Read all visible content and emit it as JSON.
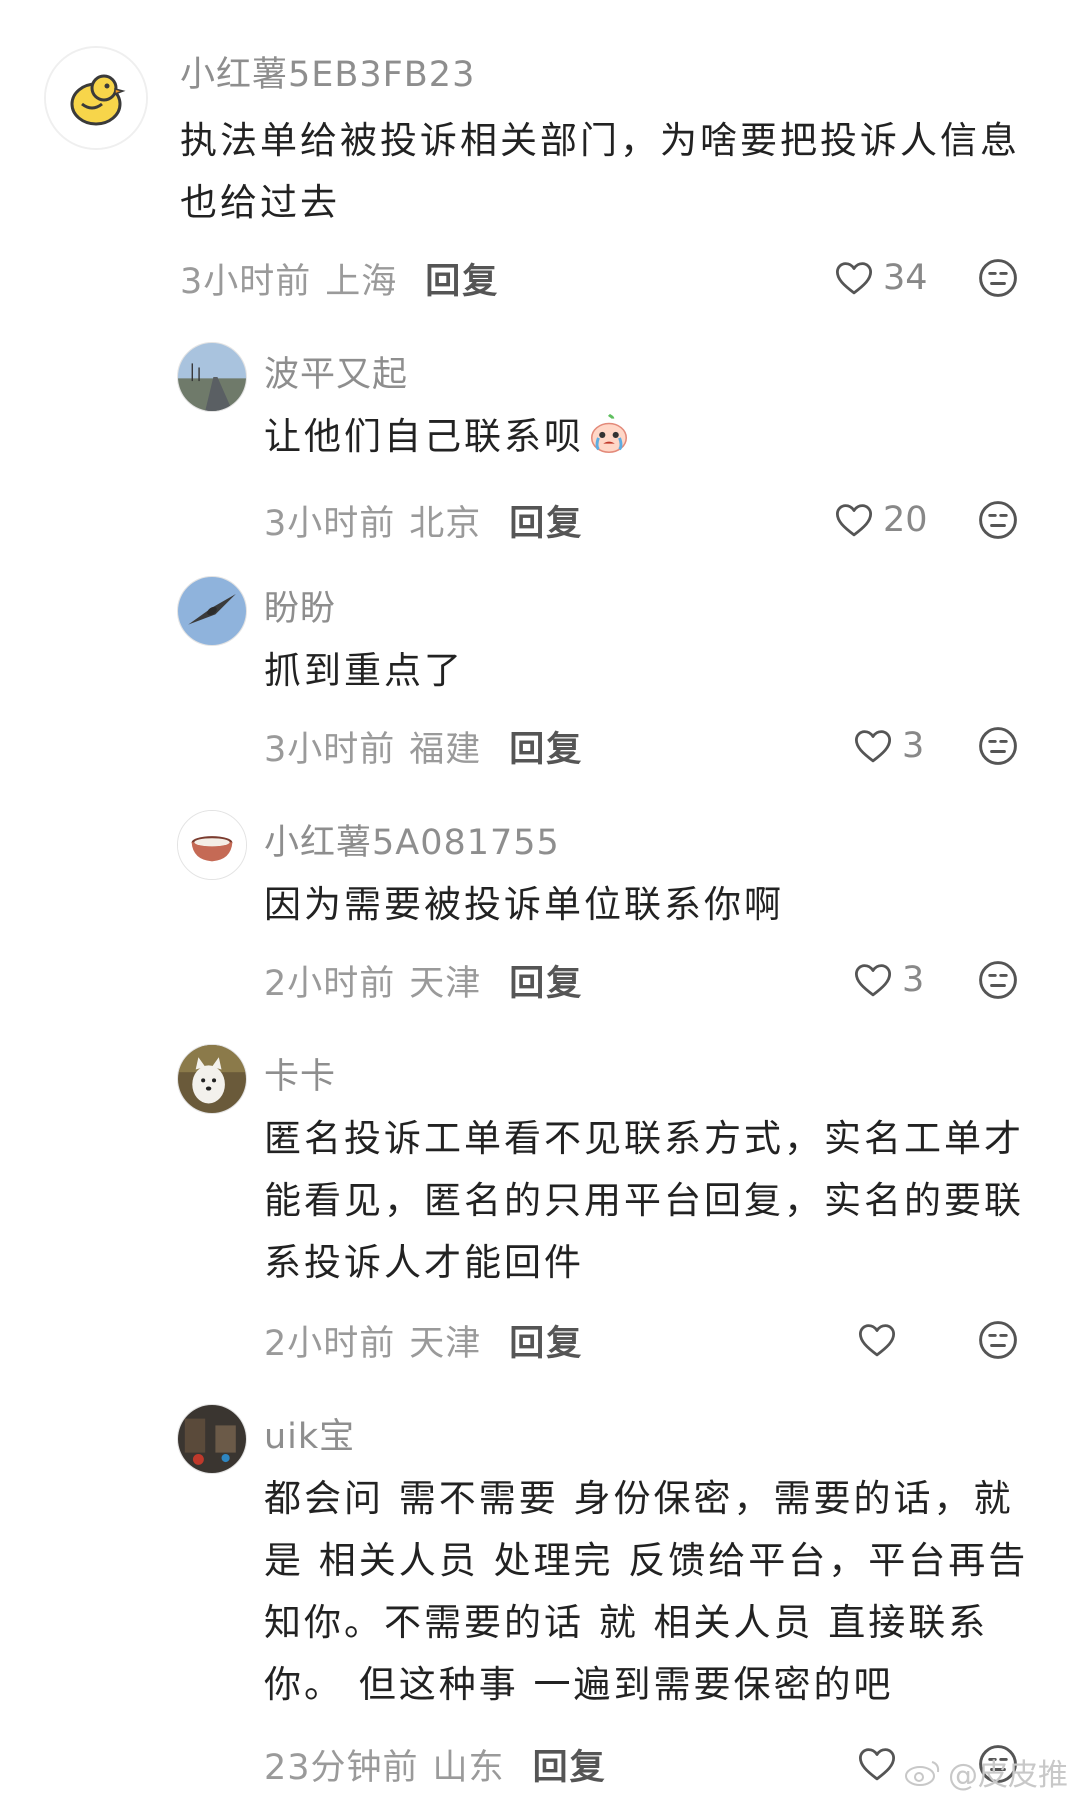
{
  "comments": [
    {
      "username": "小红薯5EB3FB23",
      "content": "执法单给被投诉相关部门，为啥要把投诉人信息\n也给过去",
      "time": "3小时前",
      "location": "上海",
      "reply_label": "回复",
      "likes": "34",
      "avatar_icon": "yellow-chick-icon"
    },
    {
      "username": "波平又起",
      "content": "让他们自己联系呗",
      "emoji": "crying-face-emoji",
      "time": "3小时前",
      "location": "北京",
      "reply_label": "回复",
      "likes": "20",
      "avatar_icon": "road-photo"
    },
    {
      "username": "盼盼",
      "content": "抓到重点了",
      "time": "3小时前",
      "location": "福建",
      "reply_label": "回复",
      "likes": "3",
      "avatar_icon": "bird-photo"
    },
    {
      "username": "小红薯5A081755",
      "content": "因为需要被投诉单位联系你啊",
      "time": "2小时前",
      "location": "天津",
      "reply_label": "回复",
      "likes": "3",
      "avatar_icon": "bowl-icon"
    },
    {
      "username": "卡卡",
      "content": "匿名投诉工单看不见联系方式，实名工单才\n能看见，匿名的只用平台回复，实名的要联\n系投诉人才能回件",
      "time": "2小时前",
      "location": "天津",
      "reply_label": "回复",
      "likes": "",
      "avatar_icon": "white-dog-photo"
    },
    {
      "username": "uik宝",
      "content": "都会问 需不需要 身份保密，需要的话，就\n是 相关人员 处理完 反馈给平台，平台再告\n知你。不需要的话 就 相关人员 直接联系\n你。 但这种事 一遍到需要保密的吧",
      "time": "23分钟前",
      "location": "山东",
      "reply_label": "回复",
      "likes": "",
      "avatar_icon": "dark-photo"
    }
  ],
  "watermark": "@皮皮推",
  "colors": {
    "username": "#8e8e8e",
    "text": "#222222",
    "meta": "#9a9a9a",
    "reply": "#555555"
  }
}
